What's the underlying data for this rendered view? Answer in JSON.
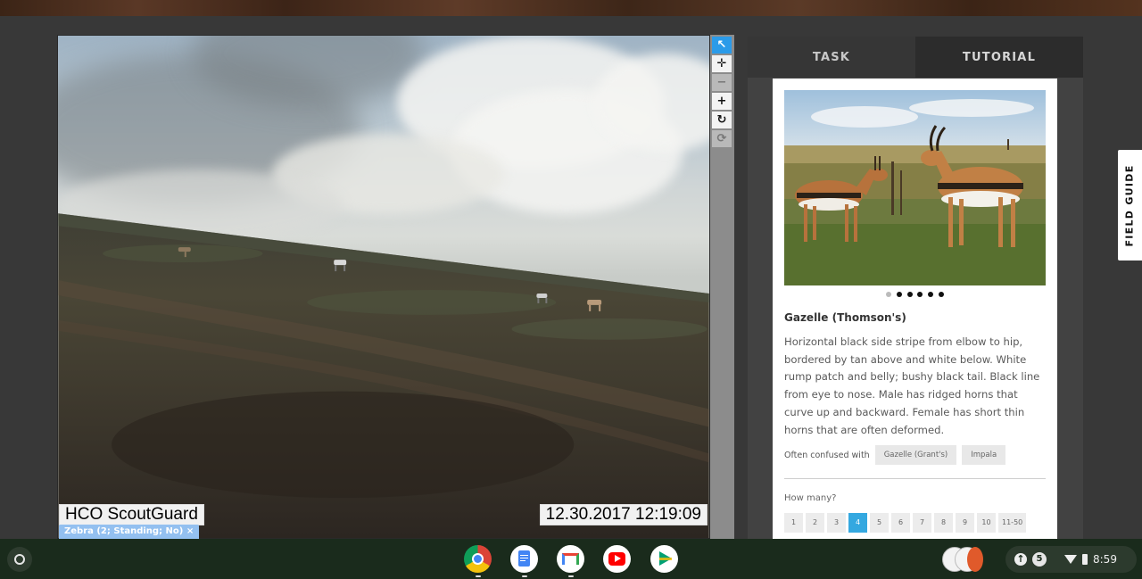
{
  "subject": {
    "camera_label": "HCO ScoutGuard",
    "timestamp": "12.30.2017 12:19:09",
    "annotation_tag": "Zebra (2; Standing; No) ×"
  },
  "tools": [
    {
      "name": "pointer",
      "glyph": "↖"
    },
    {
      "name": "pan",
      "glyph": "✛"
    },
    {
      "name": "zoom-out",
      "glyph": "−"
    },
    {
      "name": "zoom-in",
      "glyph": "+"
    },
    {
      "name": "rotate",
      "glyph": "↻"
    },
    {
      "name": "reset",
      "glyph": "⟳"
    }
  ],
  "panel": {
    "tabs": [
      {
        "label": "TASK"
      },
      {
        "label": "TUTORIAL"
      }
    ],
    "species": {
      "name": "Gazelle (Thomson's)",
      "description": "Horizontal black side stripe from elbow to hip, bordered by tan above and white below. White rump patch and belly; bushy black tail. Black line from eye to nose. Male has ridged horns that curve up and backward. Female has short thin horns that are often deformed.",
      "confused_label": "Often confused with",
      "confused_with": [
        "Gazelle (Grant's)",
        "Impala"
      ],
      "carousel_dots": 6,
      "carousel_active": 0
    },
    "how_many": {
      "label": "How many?",
      "options": [
        "1",
        "2",
        "3",
        "4",
        "5",
        "6",
        "7",
        "8",
        "9",
        "10",
        "11-50"
      ],
      "selected": "4"
    }
  },
  "field_guide_label": "FIELD GUIDE",
  "shelf": {
    "apps": [
      "chrome-icon",
      "docs-icon",
      "gmail-icon",
      "youtube-icon",
      "play-store-icon"
    ],
    "notification_count": "5",
    "time": "8:59"
  },
  "colors": {
    "accent": "#34a8e0",
    "active_tool": "#2b9be9",
    "tag": "#93c0f0"
  }
}
